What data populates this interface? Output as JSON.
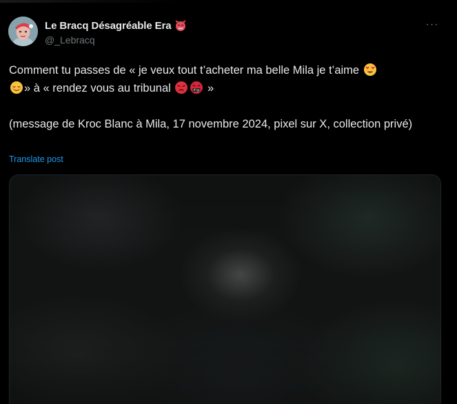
{
  "tweet": {
    "author": {
      "display_name": "Le Bracq Désagréable Era",
      "name_emoji_icon": "angry-devil-emoji-icon",
      "handle": "@_Lebracq"
    },
    "more_menu_label": "···",
    "text": {
      "line1_a": "Comment tu passes de « je veux tout t’acheter ma belle Mila je t’aime",
      "line2_a": "» à « rendez vous au tribunal",
      "line2_b": "»",
      "line3": "(message de Kroc Blanc à Mila, 17 novembre 2024, pixel sur X, collection privé)"
    },
    "emojis": [
      "heart-eyes-emoji-icon",
      "relieved-face-emoji-icon",
      "angry-face-emoji-icon",
      "cursing-face-emoji-icon"
    ],
    "translate_label": "Translate post",
    "media": {
      "type": "blurred-image"
    }
  },
  "colors": {
    "background": "#000000",
    "text_primary": "#e7e9ea",
    "text_secondary": "#71767b",
    "link": "#1d9bf0"
  }
}
